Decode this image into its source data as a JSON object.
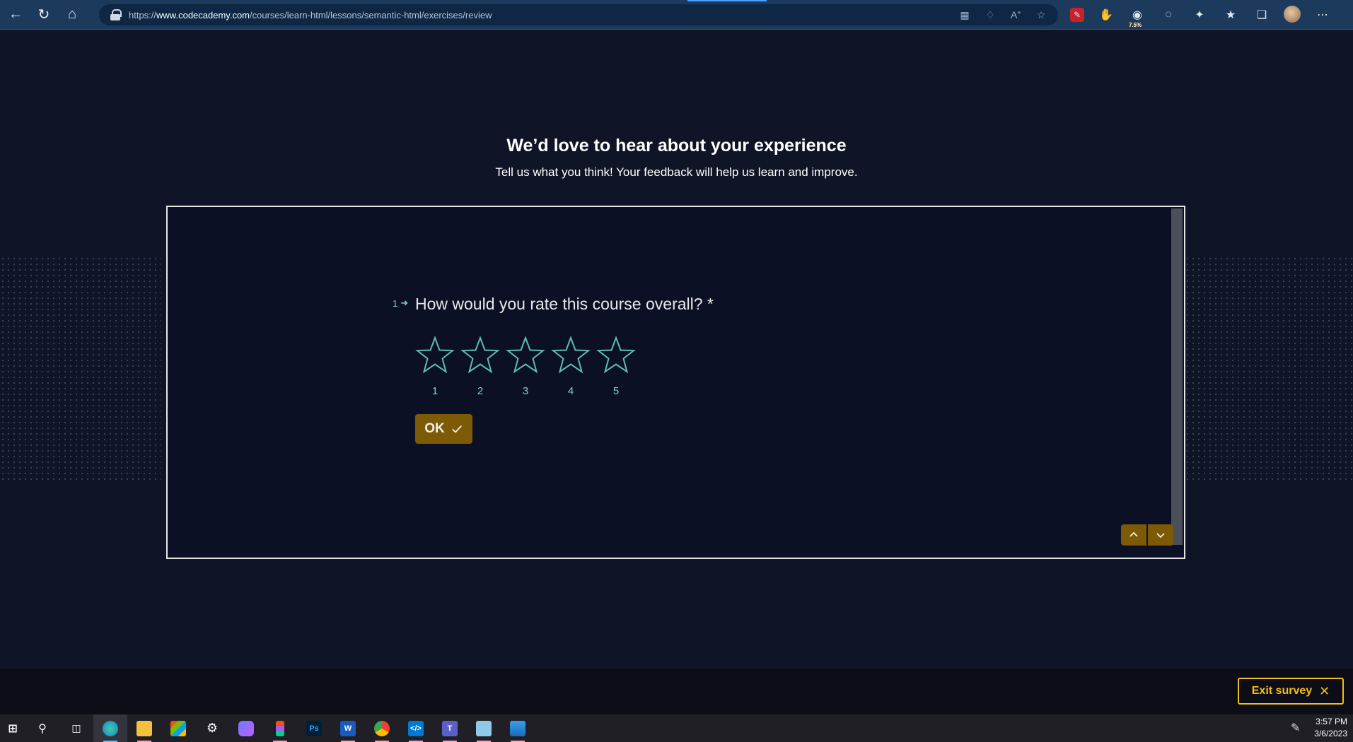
{
  "browser": {
    "url_prefix": "https://",
    "url_domain": "www.codecademy.com",
    "url_path": "/courses/learn-html/lessons/semantic-html/exercises/review",
    "badge_text": "7.5%"
  },
  "page": {
    "title": "We’d love to hear about your experience",
    "subtitle": "Tell us what you think! Your feedback will help us learn and improve."
  },
  "survey": {
    "question_number": "1",
    "question": "How would you rate this course overall? *",
    "ratings": [
      "1",
      "2",
      "3",
      "4",
      "5"
    ],
    "ok_label": "OK",
    "star_color": "#5fbdb4",
    "accent_color": "#7d5a05"
  },
  "exit": {
    "label": "Exit survey"
  },
  "clock": {
    "time": "3:57 PM",
    "date": "3/6/2023"
  }
}
